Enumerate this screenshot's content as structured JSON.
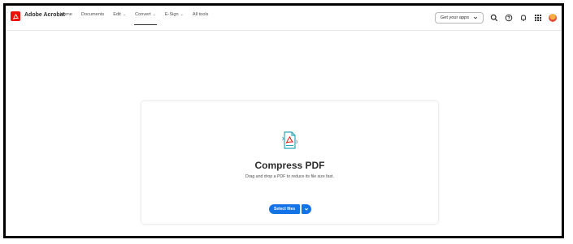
{
  "header": {
    "app_title": "Adobe Acrobat",
    "nav": [
      {
        "label": "Home",
        "caret": false,
        "active": false
      },
      {
        "label": "Documents",
        "caret": false,
        "active": false
      },
      {
        "label": "Edit",
        "caret": true,
        "active": false
      },
      {
        "label": "Convert",
        "caret": true,
        "active": true
      },
      {
        "label": "E-Sign",
        "caret": true,
        "active": false
      },
      {
        "label": "All tools",
        "caret": false,
        "active": false
      }
    ],
    "apps_button_label": "Get your apps"
  },
  "tool_card": {
    "title": "Compress PDF",
    "subtitle": "Drag and drop a PDF to reduce its file size fast.",
    "select_button_label": "Select files"
  },
  "colors": {
    "brand_red": "#eb1000",
    "accent_blue": "#1473e6",
    "icon_teal": "#2ba8b8"
  },
  "icons": [
    "acrobat-logo-icon",
    "search-icon",
    "help-icon",
    "bell-icon",
    "apps-grid-icon",
    "avatar",
    "pdf-compress-icon",
    "chevron-down-icon"
  ]
}
